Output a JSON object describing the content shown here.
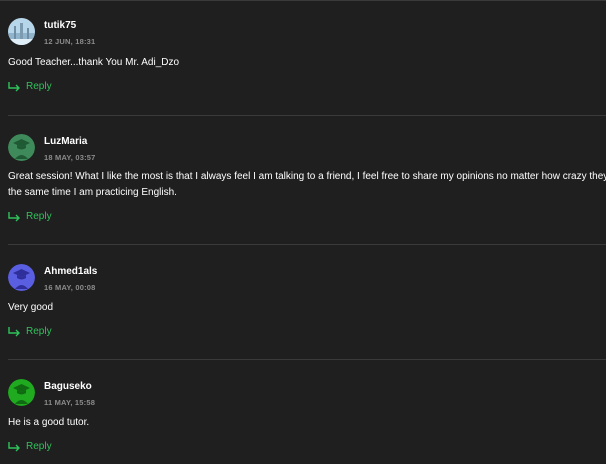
{
  "reply_label": "Reply",
  "colors": {
    "background": "#1f1f1f",
    "accent_green": "#2fc25b",
    "divider": "#3a3a3a",
    "date": "#8c8c8c"
  },
  "comments": [
    {
      "author": "tutik75",
      "date": "12 JUN, 18:31",
      "avatar": "photo-avatar",
      "text_lines": [
        "Good Teacher...thank You Mr. Adi_Dzo"
      ]
    },
    {
      "author": "LuzMaria",
      "date": "18 MAY, 03:57",
      "avatar": "graduate-avatar",
      "avatar_color": "#3f8a5a",
      "text_lines": [
        "Great session! What I like the most is that I always feel I am talking to a friend, I feel free to share my opinions no matter how crazy they a",
        "the same time I am practicing English."
      ]
    },
    {
      "author": "Ahmed1als",
      "date": "16 MAY, 00:08",
      "avatar": "graduate-avatar",
      "avatar_color": "#5a5ee0",
      "text_lines": [
        "Very good"
      ]
    },
    {
      "author": "Baguseko",
      "date": "11 MAY, 15:58",
      "avatar": "graduate-avatar",
      "avatar_color": "#1faa1f",
      "text_lines": [
        "He is a good tutor."
      ]
    }
  ]
}
